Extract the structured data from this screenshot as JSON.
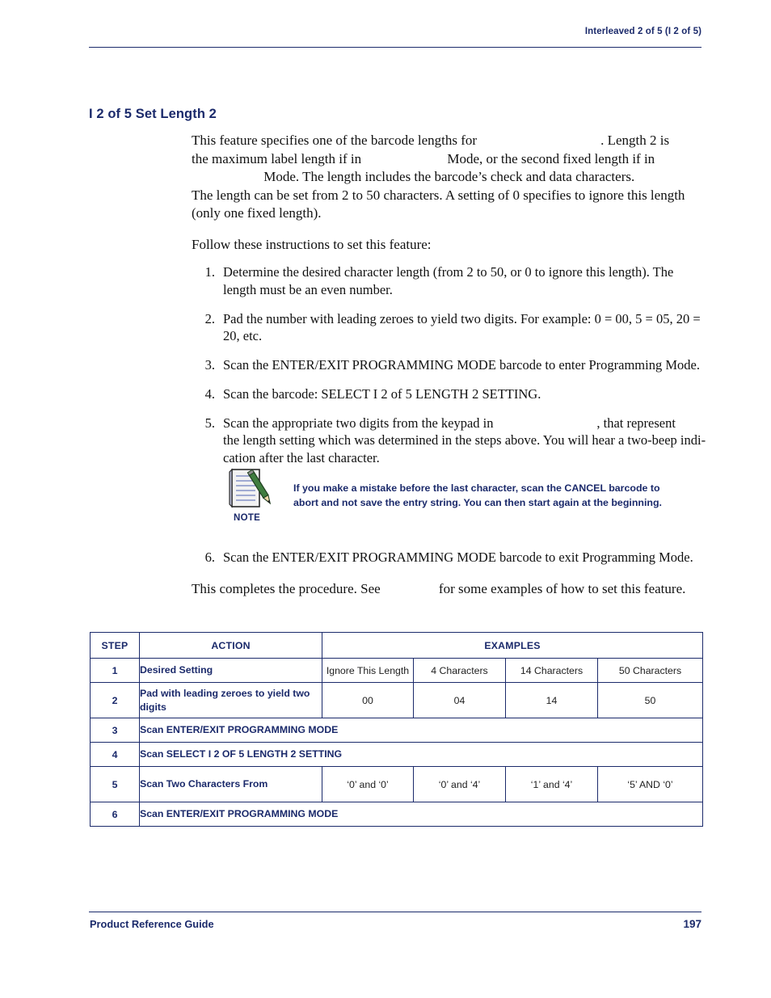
{
  "header": {
    "running_head": "Interleaved 2 of 5 (I 2 of 5)"
  },
  "title": "I 2 of 5 Set Length 2",
  "intro": {
    "p1_a": "This feature specifies one of the barcode lengths for",
    "p1_b": ". Length 2 is",
    "p2_a": "the maximum label length if in",
    "p2_b": "Mode, or the second fixed length if in",
    "p3_a": "Mode. The length includes the barcode’s check and data characters.",
    "p4": "The length can be set from 2 to 50 characters. A setting of 0 specifies to ignore this length",
    "p5": "(only one fixed length).",
    "p6": "Follow these instructions to set this feature:"
  },
  "steps": [
    {
      "num": "1.",
      "text": "Determine the desired character length (from 2 to 50, or 0 to ignore this length). The length must be an even number."
    },
    {
      "num": "2.",
      "text": "Pad the number with leading zeroes to yield two digits. For example: 0 = 00, 5 = 05, 20 = 20, etc."
    },
    {
      "num": "3.",
      "text": "Scan the ENTER/EXIT PROGRAMMING MODE barcode to enter Programming Mode."
    },
    {
      "num": "4.",
      "text": "Scan the barcode: SELECT I 2 of 5 LENGTH 2 SETTING."
    },
    {
      "num": "5.",
      "text_a": "Scan the appropriate two digits from the keypad in",
      "text_b": ", that represent",
      "text_c": "the length setting which was determined in the steps above. You will hear a two-beep indi-",
      "text_d": "cation after the last character."
    }
  ],
  "note": {
    "label": "NOTE",
    "line1": "If you make a mistake before the last character, scan the CANCEL barcode to",
    "line2": "abort and not save the entry string. You can then start again at the beginning.",
    "icon": "notepad-pencil-icon"
  },
  "step6": {
    "num": "6.",
    "text": "Scan the ENTER/EXIT PROGRAMMING MODE barcode to exit Programming Mode."
  },
  "closing": {
    "a": "This completes the procedure. See",
    "b": "for some examples of how to set this feature."
  },
  "table": {
    "headers": [
      "STEP",
      "ACTION",
      "EXAMPLES"
    ],
    "rows": [
      {
        "step": "1",
        "action": "Desired Setting",
        "examples": [
          "Ignore This Length",
          "4 Characters",
          "14 Characters",
          "50 Characters"
        ]
      },
      {
        "step": "2",
        "action": "Pad with leading zeroes to yield two digits",
        "examples": [
          "00",
          "04",
          "14",
          "50"
        ]
      },
      {
        "step": "3",
        "action": "Scan ENTER/EXIT PROGRAMMING MODE",
        "examples": []
      },
      {
        "step": "4",
        "action": "Scan SELECT I 2 OF 5 LENGTH 2 SETTING",
        "examples": []
      },
      {
        "step": "5",
        "action": "Scan Two Characters From",
        "examples": [
          "‘0’ and ‘0’",
          "‘0’ and ‘4’",
          "‘1’ and ‘4’",
          "‘5’ AND ‘0’"
        ]
      },
      {
        "step": "6",
        "action": "Scan ENTER/EXIT PROGRAMMING MODE",
        "examples": []
      }
    ]
  },
  "footer": {
    "left": "Product Reference Guide",
    "page": "197"
  },
  "colors": {
    "accent": "#1b2a6b",
    "text": "#111111"
  }
}
